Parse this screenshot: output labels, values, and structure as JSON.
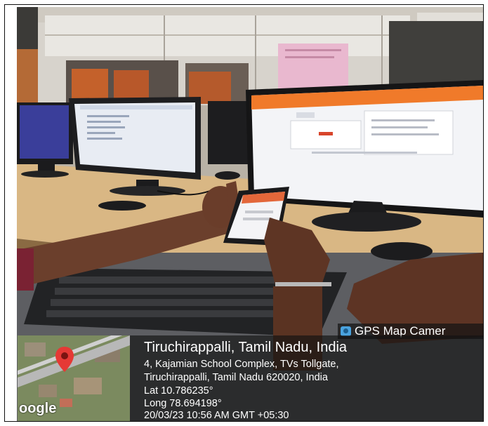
{
  "overlay": {
    "app_name": "GPS Map Camer",
    "app_icon": "camera-icon",
    "place": "Tiruchirappalli, Tamil Nadu, India",
    "address_line1": "4, Kajamian School Complex, TVs Tollgate,",
    "address_line2": "Tiruchirappalli, Tamil Nadu 620020, India",
    "lat": "Lat 10.786235°",
    "long": "Long 78.694198°",
    "datetime": "20/03/23 10:56 AM GMT +05:30",
    "map_logo": "oogle",
    "map_pin_icon": "map-pin-icon"
  },
  "colors": {
    "overlay_bg": "#121212",
    "pin_red": "#e53935",
    "site_header_orange": "#f07a2a"
  }
}
